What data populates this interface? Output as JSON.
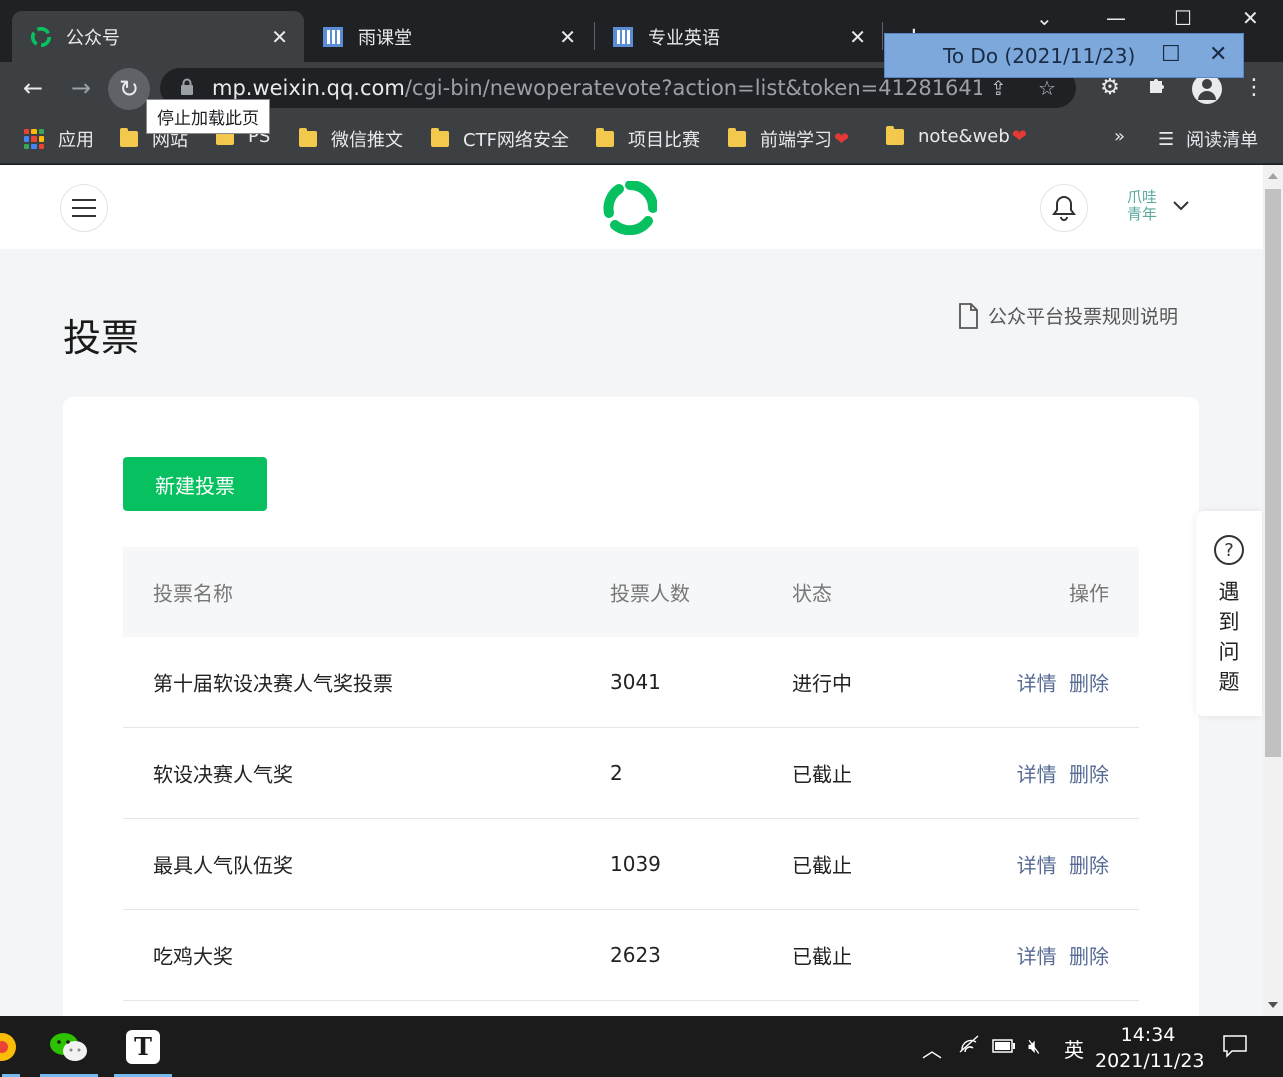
{
  "browser": {
    "tabs": [
      {
        "title": "公众号",
        "active": true
      },
      {
        "title": "雨课堂",
        "active": false
      },
      {
        "title": "专业英语",
        "active": false
      }
    ],
    "url_host": "mp.weixin.qq.com",
    "url_path": "/cgi-bin/newoperatevote?action=list&token=41281641...",
    "reload_tooltip": "停止加载此页",
    "bookmarks": [
      {
        "label": "应用"
      },
      {
        "label": "网站"
      },
      {
        "label": "PS"
      },
      {
        "label": "微信推文"
      },
      {
        "label": "CTF网络安全"
      },
      {
        "label": "项目比赛"
      },
      {
        "label": "前端学习"
      },
      {
        "label": "note&web"
      }
    ],
    "bookmarks_overflow": "»",
    "reading_list": "阅读清单"
  },
  "todo_window": {
    "title": "To Do (2021/11/23)"
  },
  "header": {
    "account_name_line1": "爪哇",
    "account_name_line2": "青年"
  },
  "page": {
    "title": "投票",
    "rules_link": "公众平台投票规则说明",
    "new_button": "新建投票"
  },
  "table": {
    "headers": {
      "name": "投票名称",
      "count": "投票人数",
      "status": "状态",
      "action": "操作"
    },
    "rows": [
      {
        "name": "第十届软设决赛人气奖投票",
        "count": "3041",
        "status": "进行中",
        "detail": "详情",
        "delete": "删除"
      },
      {
        "name": "软设决赛人气奖",
        "count": "2",
        "status": "已截止",
        "detail": "详情",
        "delete": "删除"
      },
      {
        "name": "最具人气队伍奖",
        "count": "1039",
        "status": "已截止",
        "detail": "详情",
        "delete": "删除"
      },
      {
        "name": "吃鸡大奖",
        "count": "2623",
        "status": "已截止",
        "detail": "详情",
        "delete": "删除"
      }
    ]
  },
  "help_widget": {
    "text": "遇到问题"
  },
  "taskbar": {
    "time": "14:34",
    "date": "2021/11/23",
    "ime": "英",
    "typora_letter": "T"
  },
  "colors": {
    "wechat_green": "#07c160",
    "link_blue": "#576b95",
    "chrome_dark": "#3c4043"
  },
  "icons": [
    "wechat-logo-icon",
    "menu-icon",
    "bell-icon",
    "chevron-down-icon",
    "document-icon",
    "help-question-icon"
  ]
}
